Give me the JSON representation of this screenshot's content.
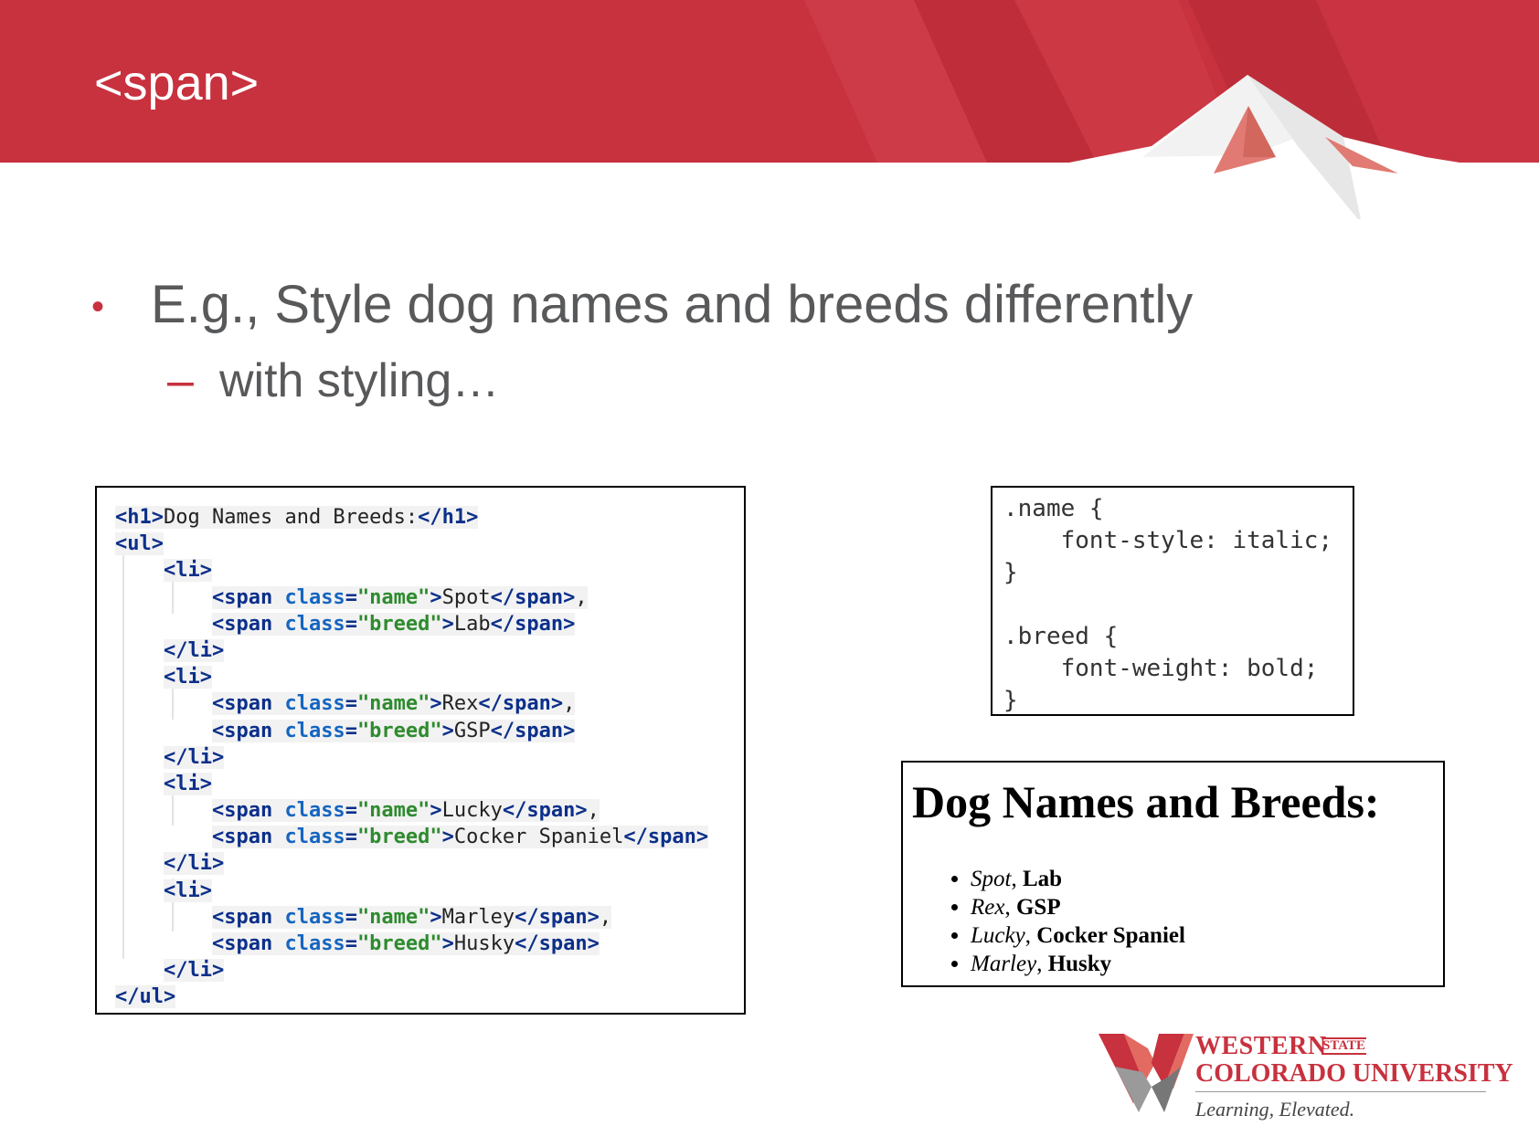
{
  "slide": {
    "title": "<span>",
    "bullet_1": "E.g., Style dog names and breeds differently",
    "bullet_2": "with styling…",
    "bullet_marker": "•",
    "sub_marker": "–"
  },
  "html_code": {
    "lines": [
      {
        "indent": 0,
        "parts": [
          [
            "tag",
            "<"
          ],
          [
            "tagname",
            "h1"
          ],
          [
            "tag",
            ">"
          ],
          [
            "txt",
            "Dog Names and Breeds:"
          ],
          [
            "tag",
            "</"
          ],
          [
            "tagname",
            "h1"
          ],
          [
            "tag",
            ">"
          ]
        ]
      },
      {
        "indent": 0,
        "parts": [
          [
            "tag",
            "<"
          ],
          [
            "tagname",
            "ul"
          ],
          [
            "tag",
            ">"
          ]
        ]
      },
      {
        "indent": 1,
        "parts": [
          [
            "tag",
            "<"
          ],
          [
            "tagname",
            "li"
          ],
          [
            "tag",
            ">"
          ]
        ]
      },
      {
        "indent": 2,
        "parts": [
          [
            "tag",
            "<"
          ],
          [
            "tagname",
            "span"
          ],
          [
            "txt",
            " "
          ],
          [
            "attr",
            "class"
          ],
          [
            "tag",
            "="
          ],
          [
            "val",
            "\"name\""
          ],
          [
            "tag",
            ">"
          ],
          [
            "txt",
            "Spot"
          ],
          [
            "tag",
            "</"
          ],
          [
            "tagname",
            "span"
          ],
          [
            "tag",
            ">"
          ],
          [
            "txt",
            ","
          ]
        ]
      },
      {
        "indent": 2,
        "parts": [
          [
            "tag",
            "<"
          ],
          [
            "tagname",
            "span"
          ],
          [
            "txt",
            " "
          ],
          [
            "attr",
            "class"
          ],
          [
            "tag",
            "="
          ],
          [
            "val",
            "\"breed\""
          ],
          [
            "tag",
            ">"
          ],
          [
            "txt",
            "Lab"
          ],
          [
            "tag",
            "</"
          ],
          [
            "tagname",
            "span"
          ],
          [
            "tag",
            ">"
          ]
        ]
      },
      {
        "indent": 1,
        "parts": [
          [
            "tag",
            "</"
          ],
          [
            "tagname",
            "li"
          ],
          [
            "tag",
            ">"
          ]
        ]
      },
      {
        "indent": 1,
        "parts": [
          [
            "tag",
            "<"
          ],
          [
            "tagname",
            "li"
          ],
          [
            "tag",
            ">"
          ]
        ]
      },
      {
        "indent": 2,
        "parts": [
          [
            "tag",
            "<"
          ],
          [
            "tagname",
            "span"
          ],
          [
            "txt",
            " "
          ],
          [
            "attr",
            "class"
          ],
          [
            "tag",
            "="
          ],
          [
            "val",
            "\"name\""
          ],
          [
            "tag",
            ">"
          ],
          [
            "txt",
            "Rex"
          ],
          [
            "tag",
            "</"
          ],
          [
            "tagname",
            "span"
          ],
          [
            "tag",
            ">"
          ],
          [
            "txt",
            ","
          ]
        ]
      },
      {
        "indent": 2,
        "parts": [
          [
            "tag",
            "<"
          ],
          [
            "tagname",
            "span"
          ],
          [
            "txt",
            " "
          ],
          [
            "attr",
            "class"
          ],
          [
            "tag",
            "="
          ],
          [
            "val",
            "\"breed\""
          ],
          [
            "tag",
            ">"
          ],
          [
            "txt",
            "GSP"
          ],
          [
            "tag",
            "</"
          ],
          [
            "tagname",
            "span"
          ],
          [
            "tag",
            ">"
          ]
        ]
      },
      {
        "indent": 1,
        "parts": [
          [
            "tag",
            "</"
          ],
          [
            "tagname",
            "li"
          ],
          [
            "tag",
            ">"
          ]
        ]
      },
      {
        "indent": 1,
        "parts": [
          [
            "tag",
            "<"
          ],
          [
            "tagname",
            "li"
          ],
          [
            "tag",
            ">"
          ]
        ]
      },
      {
        "indent": 2,
        "parts": [
          [
            "tag",
            "<"
          ],
          [
            "tagname",
            "span"
          ],
          [
            "txt",
            " "
          ],
          [
            "attr",
            "class"
          ],
          [
            "tag",
            "="
          ],
          [
            "val",
            "\"name\""
          ],
          [
            "tag",
            ">"
          ],
          [
            "txt",
            "Lucky"
          ],
          [
            "tag",
            "</"
          ],
          [
            "tagname",
            "span"
          ],
          [
            "tag",
            ">"
          ],
          [
            "txt",
            ","
          ]
        ]
      },
      {
        "indent": 2,
        "parts": [
          [
            "tag",
            "<"
          ],
          [
            "tagname",
            "span"
          ],
          [
            "txt",
            " "
          ],
          [
            "attr",
            "class"
          ],
          [
            "tag",
            "="
          ],
          [
            "val",
            "\"breed\""
          ],
          [
            "tag",
            ">"
          ],
          [
            "txt",
            "Cocker Spaniel"
          ],
          [
            "tag",
            "</"
          ],
          [
            "tagname",
            "span"
          ],
          [
            "tag",
            ">"
          ]
        ]
      },
      {
        "indent": 1,
        "parts": [
          [
            "tag",
            "</"
          ],
          [
            "tagname",
            "li"
          ],
          [
            "tag",
            ">"
          ]
        ]
      },
      {
        "indent": 1,
        "parts": [
          [
            "tag",
            "<"
          ],
          [
            "tagname",
            "li"
          ],
          [
            "tag",
            ">"
          ]
        ]
      },
      {
        "indent": 2,
        "parts": [
          [
            "tag",
            "<"
          ],
          [
            "tagname",
            "span"
          ],
          [
            "txt",
            " "
          ],
          [
            "attr",
            "class"
          ],
          [
            "tag",
            "="
          ],
          [
            "val",
            "\"name\""
          ],
          [
            "tag",
            ">"
          ],
          [
            "txt",
            "Marley"
          ],
          [
            "tag",
            "</"
          ],
          [
            "tagname",
            "span"
          ],
          [
            "tag",
            ">"
          ],
          [
            "txt",
            ","
          ]
        ]
      },
      {
        "indent": 2,
        "parts": [
          [
            "tag",
            "<"
          ],
          [
            "tagname",
            "span"
          ],
          [
            "txt",
            " "
          ],
          [
            "attr",
            "class"
          ],
          [
            "tag",
            "="
          ],
          [
            "val",
            "\"breed\""
          ],
          [
            "tag",
            ">"
          ],
          [
            "txt",
            "Husky"
          ],
          [
            "tag",
            "</"
          ],
          [
            "tagname",
            "span"
          ],
          [
            "tag",
            ">"
          ]
        ]
      },
      {
        "indent": 1,
        "parts": [
          [
            "tag",
            "</"
          ],
          [
            "tagname",
            "li"
          ],
          [
            "tag",
            ">"
          ]
        ]
      },
      {
        "indent": 0,
        "parts": [
          [
            "tag",
            "</"
          ],
          [
            "tagname",
            "ul"
          ],
          [
            "tag",
            ">"
          ]
        ]
      }
    ]
  },
  "css_code": {
    "lines": [
      ".name {",
      "    font-style: italic;",
      "}",
      "",
      ".breed {",
      "    font-weight: bold;",
      "}"
    ]
  },
  "rendered": {
    "heading": "Dog Names and Breeds:",
    "items": [
      {
        "name": "Spot",
        "breed": "Lab"
      },
      {
        "name": "Rex",
        "breed": "GSP"
      },
      {
        "name": "Lucky",
        "breed": "Cocker Spaniel"
      },
      {
        "name": "Marley",
        "breed": "Husky"
      }
    ]
  },
  "logo": {
    "line_1": "WESTERN",
    "state": "STATE",
    "line_2": "COLORADO UNIVERSITY",
    "tagline": "Learning, Elevated."
  },
  "colors": {
    "banner_red": "#c8313e",
    "text_gray": "#58595b"
  }
}
